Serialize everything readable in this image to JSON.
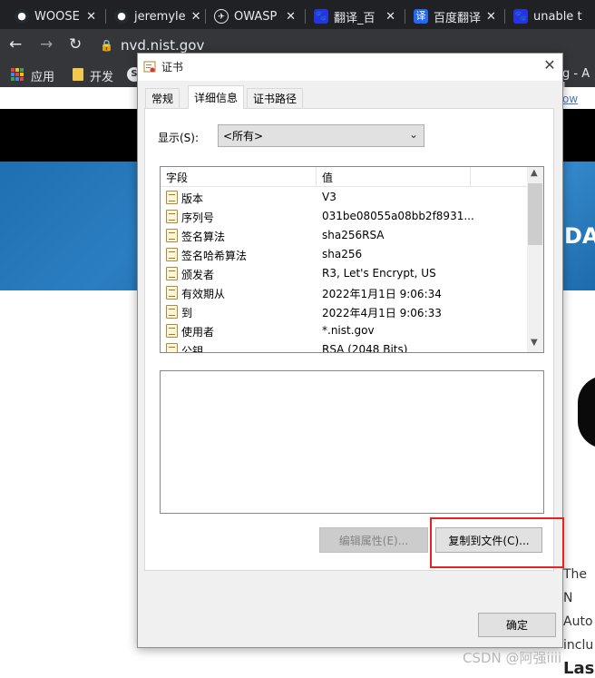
{
  "browser": {
    "tabs": [
      {
        "label": "WOOSE",
        "fav": "github-icon",
        "color": "#24292e"
      },
      {
        "label": "jeremyle",
        "fav": "github-icon",
        "color": "#24292e"
      },
      {
        "label": "OWASP",
        "fav": "owasp-icon",
        "color": "#3a3a3a"
      },
      {
        "label": "翻译_百",
        "fav": "baidu-icon",
        "color": "#2932e1"
      },
      {
        "label": "百度翻译",
        "fav": "fanyi-icon",
        "color": "#2468f2"
      },
      {
        "label": "unable t",
        "fav": "baidu-icon",
        "color": "#2932e1"
      }
    ],
    "url": "nvd.nist.gov",
    "bookmarks": [
      {
        "label": "应用"
      },
      {
        "label": "开发"
      }
    ]
  },
  "page": {
    "side_g": "g - A l",
    "side_link": "ow you",
    "side_banner": "DAT",
    "side_lines": [
      "The N",
      "Auto",
      "inclu"
    ],
    "side_heading": "Las",
    "watermark": "CSDN @阿强iiii"
  },
  "dialog": {
    "title": "证书",
    "tabs": [
      "常规",
      "详细信息",
      "证书路径"
    ],
    "active_tab": 1,
    "show_label": "显示(S):",
    "show_value": "<所有>",
    "columns": [
      "字段",
      "值"
    ],
    "rows": [
      {
        "field": "版本",
        "value": "V3"
      },
      {
        "field": "序列号",
        "value": "031be08055a08bb2f8931..."
      },
      {
        "field": "签名算法",
        "value": "sha256RSA"
      },
      {
        "field": "签名哈希算法",
        "value": "sha256"
      },
      {
        "field": "颁发者",
        "value": "R3, Let's Encrypt, US"
      },
      {
        "field": "有效期从",
        "value": "2022年1月1日 9:06:34"
      },
      {
        "field": "到",
        "value": "2022年4月1日 9:06:33"
      },
      {
        "field": "使用者",
        "value": "*.nist.gov"
      },
      {
        "field": "公钥",
        "value": "RSA (2048 Bits)"
      }
    ],
    "edit_button": "编辑属性(E)...",
    "copy_button": "复制到文件(C)...",
    "ok_button": "确定"
  }
}
